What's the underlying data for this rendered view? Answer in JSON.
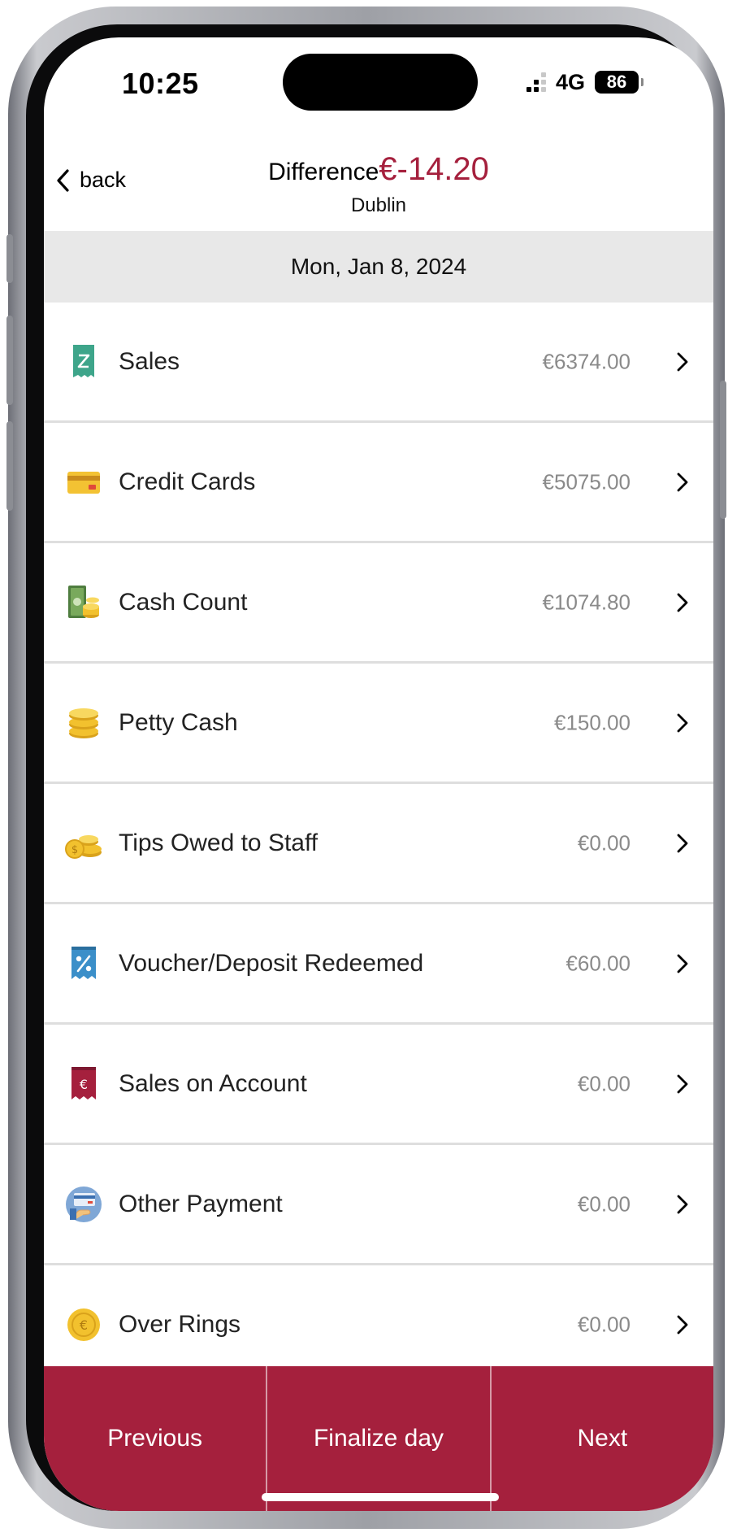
{
  "status_bar": {
    "time": "10:25",
    "network": "4G",
    "battery": "86"
  },
  "header": {
    "back_label": "back",
    "title_label": "Difference",
    "difference_amount": "€-14.20",
    "location": "Dublin"
  },
  "date": "Mon, Jan 8, 2024",
  "rows": [
    {
      "label": "Sales",
      "amount": "€6374.00",
      "icon": "z-report-icon"
    },
    {
      "label": "Credit Cards",
      "amount": "€5075.00",
      "icon": "credit-card-icon"
    },
    {
      "label": "Cash Count",
      "amount": "€1074.80",
      "icon": "cash-coins-icon"
    },
    {
      "label": "Petty Cash",
      "amount": "€150.00",
      "icon": "coin-stack-icon"
    },
    {
      "label": "Tips Owed to Staff",
      "amount": "€0.00",
      "icon": "coins-icon"
    },
    {
      "label": "Voucher/Deposit Redeemed",
      "amount": "€60.00",
      "icon": "voucher-percent-icon"
    },
    {
      "label": "Sales on Account",
      "amount": "€0.00",
      "icon": "euro-receipt-icon"
    },
    {
      "label": "Other Payment",
      "amount": "€0.00",
      "icon": "card-payment-icon"
    },
    {
      "label": "Over Rings",
      "amount": "€0.00",
      "icon": "euro-coin-icon"
    }
  ],
  "footer": {
    "previous_label": "Previous",
    "finalize_label": "Finalize day",
    "next_label": "Next"
  },
  "colors": {
    "accent": "#a5203d",
    "amount_text": "#8a8a8a",
    "date_band": "#e8e8e8"
  }
}
